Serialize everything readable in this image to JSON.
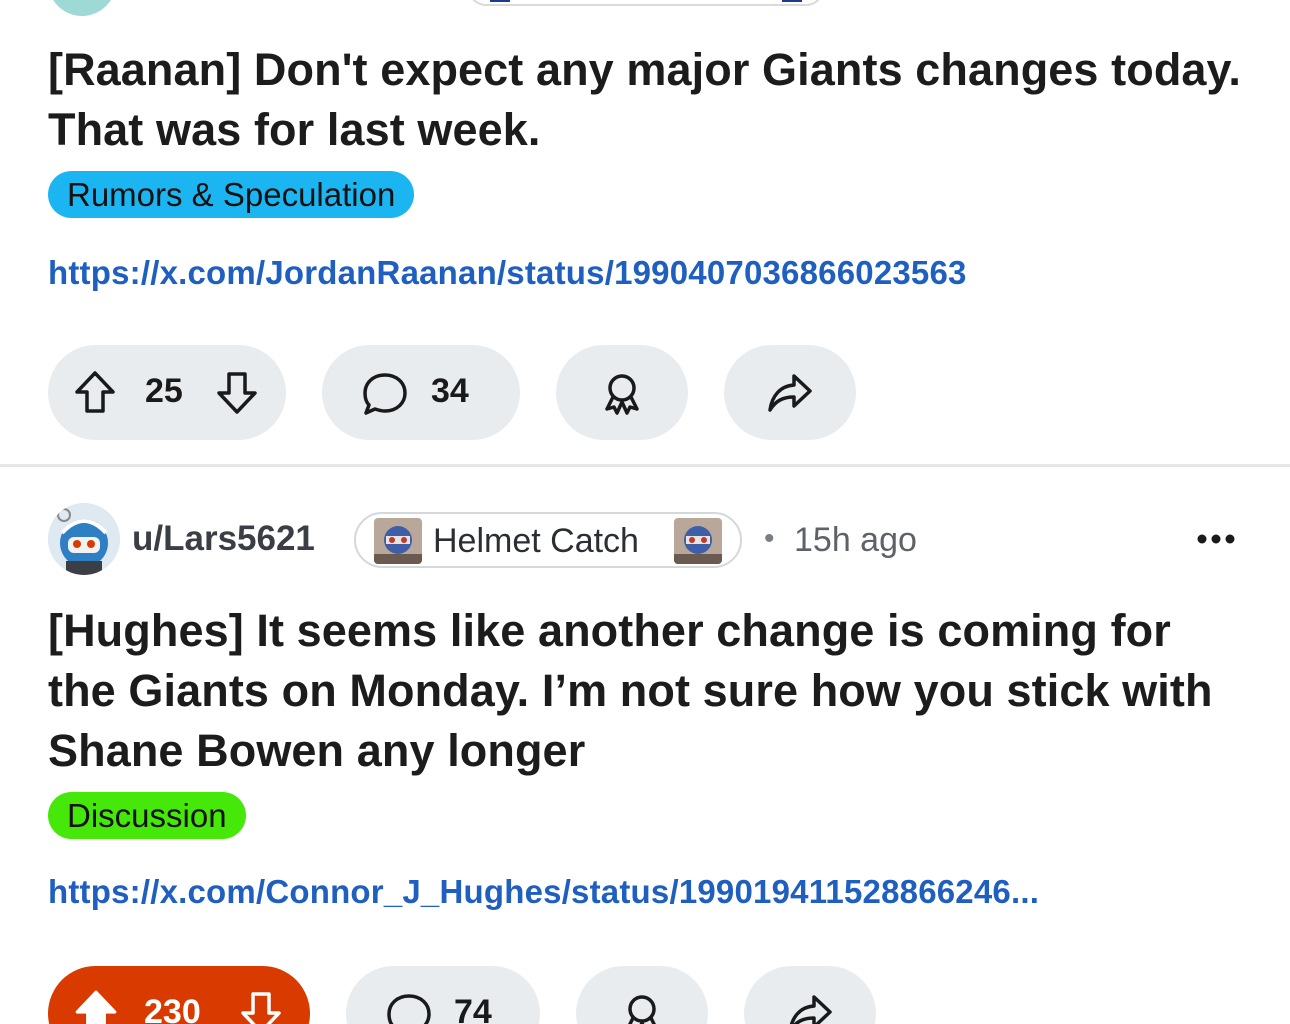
{
  "post1": {
    "title": "[Raanan] Don't expect any major Giants changes today. That was for last week.",
    "flair": "Rumors & Speculation",
    "flair_color": "#1bb6f2",
    "link": "https://x.com/JordanRaanan/status/1990407036866023563",
    "votes": "25",
    "comments": "34"
  },
  "post2": {
    "username": "u/Lars5621",
    "user_flair": "Helmet Catch",
    "time": "15h ago",
    "title": "[Hughes] It seems like another change is coming for the Giants on Monday. I’m not sure how you stick with Shane Bowen any longer",
    "flair": "Discussion",
    "flair_color": "#46e80a",
    "link": "https://x.com/Connor_J_Hughes/status/199019411528866246...",
    "votes": "230",
    "vote_pill_color": "#d93a00",
    "comments": "74"
  },
  "icons": {
    "upvote": "upvote-arrow-icon",
    "downvote": "downvote-arrow-icon",
    "comment": "comment-bubble-icon",
    "award": "award-ribbon-icon",
    "share": "share-arrow-icon",
    "more": "more-dots-icon"
  }
}
